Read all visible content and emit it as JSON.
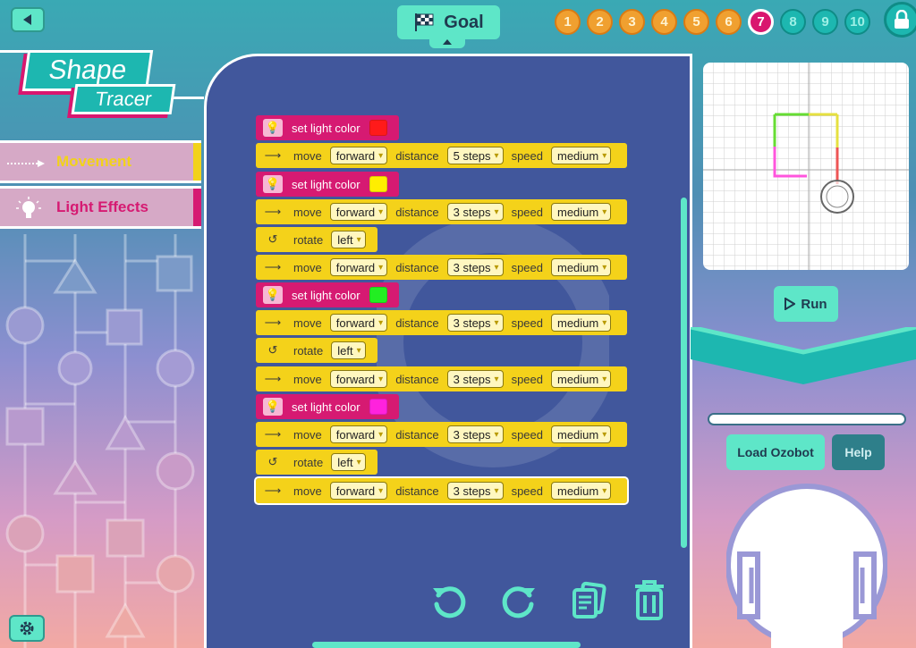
{
  "header": {
    "goal_label": "Goal",
    "levels": [
      {
        "n": "1",
        "state": "done"
      },
      {
        "n": "2",
        "state": "done"
      },
      {
        "n": "3",
        "state": "done"
      },
      {
        "n": "4",
        "state": "done"
      },
      {
        "n": "5",
        "state": "done"
      },
      {
        "n": "6",
        "state": "done"
      },
      {
        "n": "7",
        "state": "current"
      },
      {
        "n": "8",
        "state": "todo"
      },
      {
        "n": "9",
        "state": "todo"
      },
      {
        "n": "10",
        "state": "todo"
      }
    ]
  },
  "logo": {
    "line1": "Shape",
    "line2": "Tracer"
  },
  "categories": [
    {
      "label": "Movement",
      "color": "#f2d21a",
      "icon": "arrow-icon"
    },
    {
      "label": "Light Effects",
      "color": "#d61a72",
      "icon": "lightbulb-icon"
    }
  ],
  "blocks": {
    "b0": {
      "text": "set light color",
      "color": "#ff1a1a"
    },
    "b1": {
      "kw1": "move",
      "dir": "forward",
      "kw2": "distance",
      "dist": "5 steps",
      "kw3": "speed",
      "speed": "medium"
    },
    "b2": {
      "text": "set light color",
      "color": "#ffee00"
    },
    "b3": {
      "kw1": "move",
      "dir": "forward",
      "kw2": "distance",
      "dist": "3 steps",
      "kw3": "speed",
      "speed": "medium"
    },
    "b4": {
      "kw": "rotate",
      "dir": "left"
    },
    "b5": {
      "kw1": "move",
      "dir": "forward",
      "kw2": "distance",
      "dist": "3 steps",
      "kw3": "speed",
      "speed": "medium"
    },
    "b6": {
      "text": "set light color",
      "color": "#22ee22"
    },
    "b7": {
      "kw1": "move",
      "dir": "forward",
      "kw2": "distance",
      "dist": "3 steps",
      "kw3": "speed",
      "speed": "medium"
    },
    "b8": {
      "kw": "rotate",
      "dir": "left"
    },
    "b9": {
      "kw1": "move",
      "dir": "forward",
      "kw2": "distance",
      "dist": "3 steps",
      "kw3": "speed",
      "speed": "medium"
    },
    "b10": {
      "text": "set light color",
      "color": "#ff22dd"
    },
    "b11": {
      "kw1": "move",
      "dir": "forward",
      "kw2": "distance",
      "dist": "3 steps",
      "kw3": "speed",
      "speed": "medium"
    },
    "b12": {
      "kw": "rotate",
      "dir": "left"
    },
    "b13": {
      "kw1": "move",
      "dir": "forward",
      "kw2": "distance",
      "dist": "3 steps",
      "kw3": "speed",
      "speed": "medium"
    }
  },
  "right_panel": {
    "run_label": "Run",
    "load_label": "Load Ozobot",
    "help_label": "Help"
  },
  "actions": {
    "undo": "undo-icon",
    "redo": "redo-icon",
    "duplicate": "copy-icon",
    "delete": "trash-icon"
  }
}
